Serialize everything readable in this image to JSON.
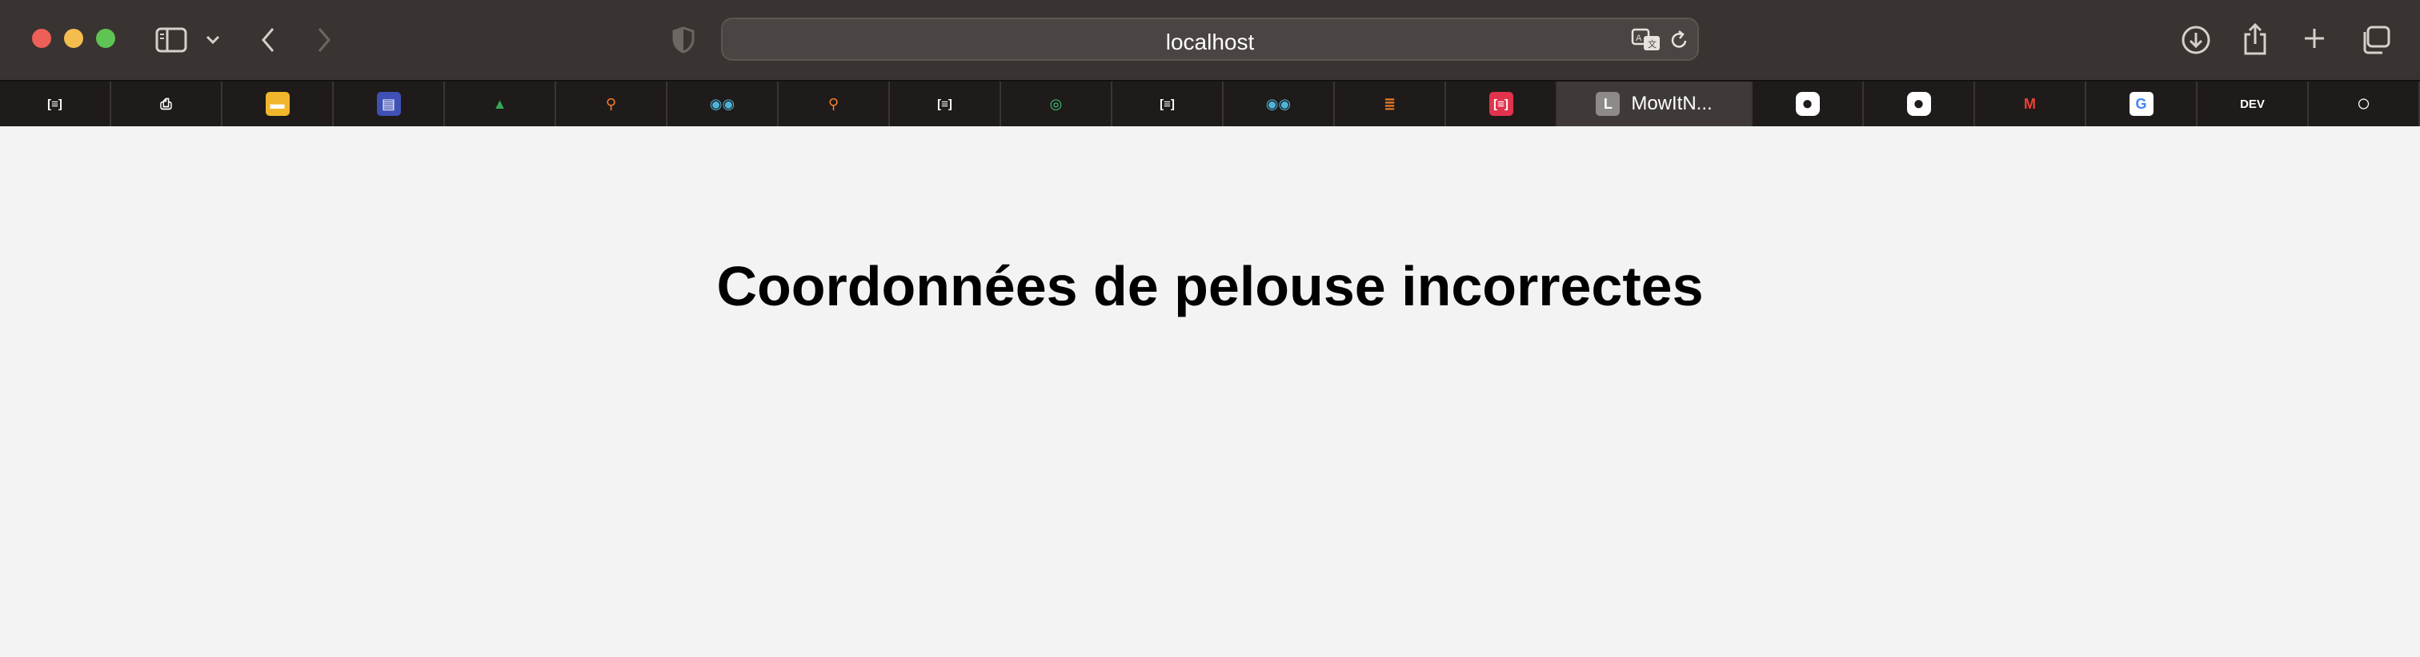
{
  "window": {
    "traffic_lights": {
      "close": "#ee5f57",
      "minimize": "#f5bd4f",
      "zoom": "#5fc453"
    }
  },
  "address_bar": {
    "url": "localhost"
  },
  "tabs": [
    {
      "icon": "reader-icon",
      "glyph": "[≡]",
      "color": "#ffffff",
      "bg": "transparent"
    },
    {
      "icon": "printer-icon",
      "glyph": "⎙",
      "color": "#ffffff",
      "bg": "transparent"
    },
    {
      "icon": "slides-icon",
      "glyph": "▬",
      "color": "#ffffff",
      "bg": "#f2b52b"
    },
    {
      "icon": "forms-icon",
      "glyph": "▤",
      "color": "#ffffff",
      "bg": "#3f51b5"
    },
    {
      "icon": "google-drive-icon",
      "glyph": "▲",
      "color": "#34a853",
      "bg": "transparent"
    },
    {
      "icon": "location-pin-icon",
      "glyph": "⚲",
      "color": "#f57c2b",
      "bg": "transparent"
    },
    {
      "icon": "eyes-icon",
      "glyph": "◉◉",
      "color": "#4fb3d9",
      "bg": "transparent"
    },
    {
      "icon": "location-pin-icon",
      "glyph": "⚲",
      "color": "#f57c2b",
      "bg": "transparent"
    },
    {
      "icon": "reader-icon",
      "glyph": "[≡]",
      "color": "#ffffff",
      "bg": "transparent"
    },
    {
      "icon": "green-circle-icon",
      "glyph": "◎",
      "color": "#3ec97a",
      "bg": "transparent"
    },
    {
      "icon": "reader-icon",
      "glyph": "[≡]",
      "color": "#ffffff",
      "bg": "transparent"
    },
    {
      "icon": "eyes-icon",
      "glyph": "◉◉",
      "color": "#4fb3d9",
      "bg": "transparent"
    },
    {
      "icon": "stackoverflow-icon",
      "glyph": "≣",
      "color": "#f48024",
      "bg": "transparent"
    },
    {
      "icon": "red-reader-icon",
      "glyph": "[≡]",
      "color": "#ffffff",
      "bg": "#e2334d"
    },
    {
      "icon": "letter-l-icon",
      "glyph": "L",
      "color": "#ffffff",
      "bg": "#8e8a88",
      "label": "MowItN...",
      "active": true
    },
    {
      "icon": "github-icon",
      "glyph": "●",
      "color": "#1e1b1a",
      "bg": "#ffffff"
    },
    {
      "icon": "github-icon",
      "glyph": "●",
      "color": "#1e1b1a",
      "bg": "#ffffff"
    },
    {
      "icon": "gmail-icon",
      "glyph": "M",
      "color": "#ea4335",
      "bg": "transparent"
    },
    {
      "icon": "google-icon",
      "glyph": "G",
      "color": "#4285f4",
      "bg": "#ffffff"
    },
    {
      "icon": "dev-icon",
      "glyph": "DEV",
      "color": "#ffffff",
      "bg": "transparent"
    },
    {
      "icon": "circle-icon",
      "glyph": "○",
      "color": "#ffffff",
      "bg": "transparent"
    }
  ],
  "page": {
    "heading": "Coordonnées de pelouse incorrectes"
  }
}
